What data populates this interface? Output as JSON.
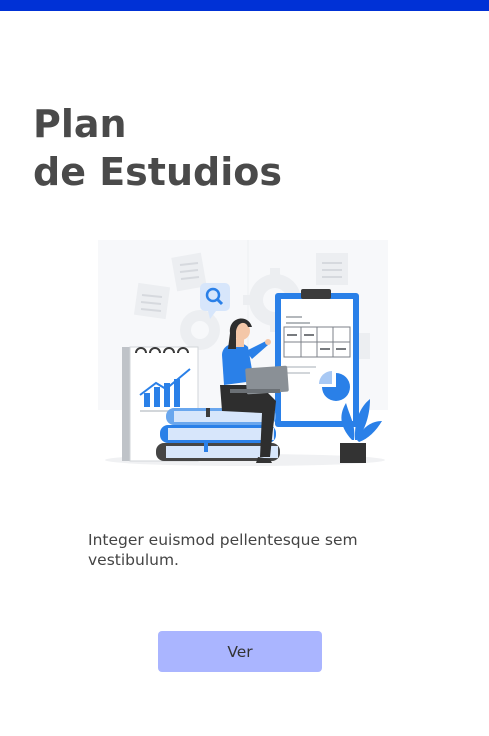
{
  "header": {
    "bar_color": "#0031d6"
  },
  "hero": {
    "title_line1": "Plan",
    "title_line2": "de Estudios",
    "illustration": "study-plan-illustration"
  },
  "content": {
    "description": "Integer euismod pellentesque sem vestibulum."
  },
  "actions": {
    "view_label": "Ver",
    "button_color": "#aab5ff"
  },
  "colors": {
    "accent": "#2a80e8",
    "title_text": "#4a4a4a"
  }
}
